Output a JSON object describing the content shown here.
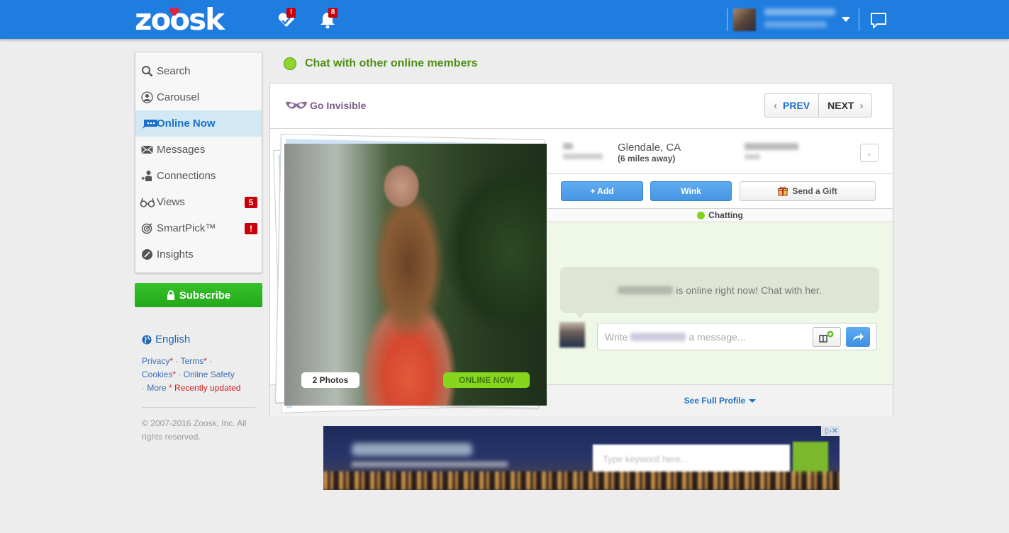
{
  "header": {
    "logo": "zoosk",
    "icons": [
      {
        "name": "smartpick-heart-icon",
        "badge": "!"
      },
      {
        "name": "notifications-bell-icon",
        "badge": "8"
      }
    ],
    "user_menu": {
      "icon": "user-avatar",
      "caret": "chevron-down-icon"
    },
    "chat_icon": "chat-bubble-icon",
    "colors": {
      "bar": "#1f7de0",
      "badge": "#c9000b"
    }
  },
  "sidebar": {
    "items": [
      {
        "label": "Search",
        "icon": "search-icon",
        "active": false,
        "badge": null
      },
      {
        "label": "Carousel",
        "icon": "carousel-icon",
        "active": false,
        "badge": null
      },
      {
        "label": "Online Now",
        "icon": "chat-dots-icon",
        "active": true,
        "badge": null
      },
      {
        "label": "Messages",
        "icon": "envelope-icon",
        "active": false,
        "badge": null
      },
      {
        "label": "Connections",
        "icon": "connections-icon",
        "active": false,
        "badge": null
      },
      {
        "label": "Views",
        "icon": "glasses-icon",
        "active": false,
        "badge": "5"
      },
      {
        "label": "SmartPick™",
        "icon": "target-icon",
        "active": false,
        "badge": "!"
      },
      {
        "label": "Insights",
        "icon": "insights-icon",
        "active": false,
        "badge": null
      }
    ],
    "subscribe_label": "Subscribe",
    "language": "English",
    "links": {
      "privacy": "Privacy",
      "terms": "Terms",
      "cookies": "Cookies",
      "online_safety": "Online Safety",
      "more": "More",
      "star": "*",
      "sep": "·",
      "recently_updated": "* Recently updated"
    },
    "copyright": "© 2007-2016 Zoosk, Inc. All rights reserved."
  },
  "main": {
    "heading": "Chat with other online members",
    "go_invisible": "Go Invisible",
    "prev_label": "PREV",
    "next_label": "NEXT",
    "profile": {
      "photos_count": "2 Photos",
      "online_badge": "ONLINE NOW",
      "city": "Glendale, CA",
      "distance": "(6 miles away)"
    },
    "actions": {
      "add": "+ Add",
      "wink": "Wink",
      "gift": "Send a Gift"
    },
    "chat_status": "Chatting",
    "bubble_text": "is online right now! Chat with her.",
    "message_prefix": "Write",
    "message_suffix": "a message...",
    "see_full_profile": "See Full Profile"
  },
  "ad": {
    "input_placeholder": "Type keyword here...",
    "close": "▷✕"
  }
}
